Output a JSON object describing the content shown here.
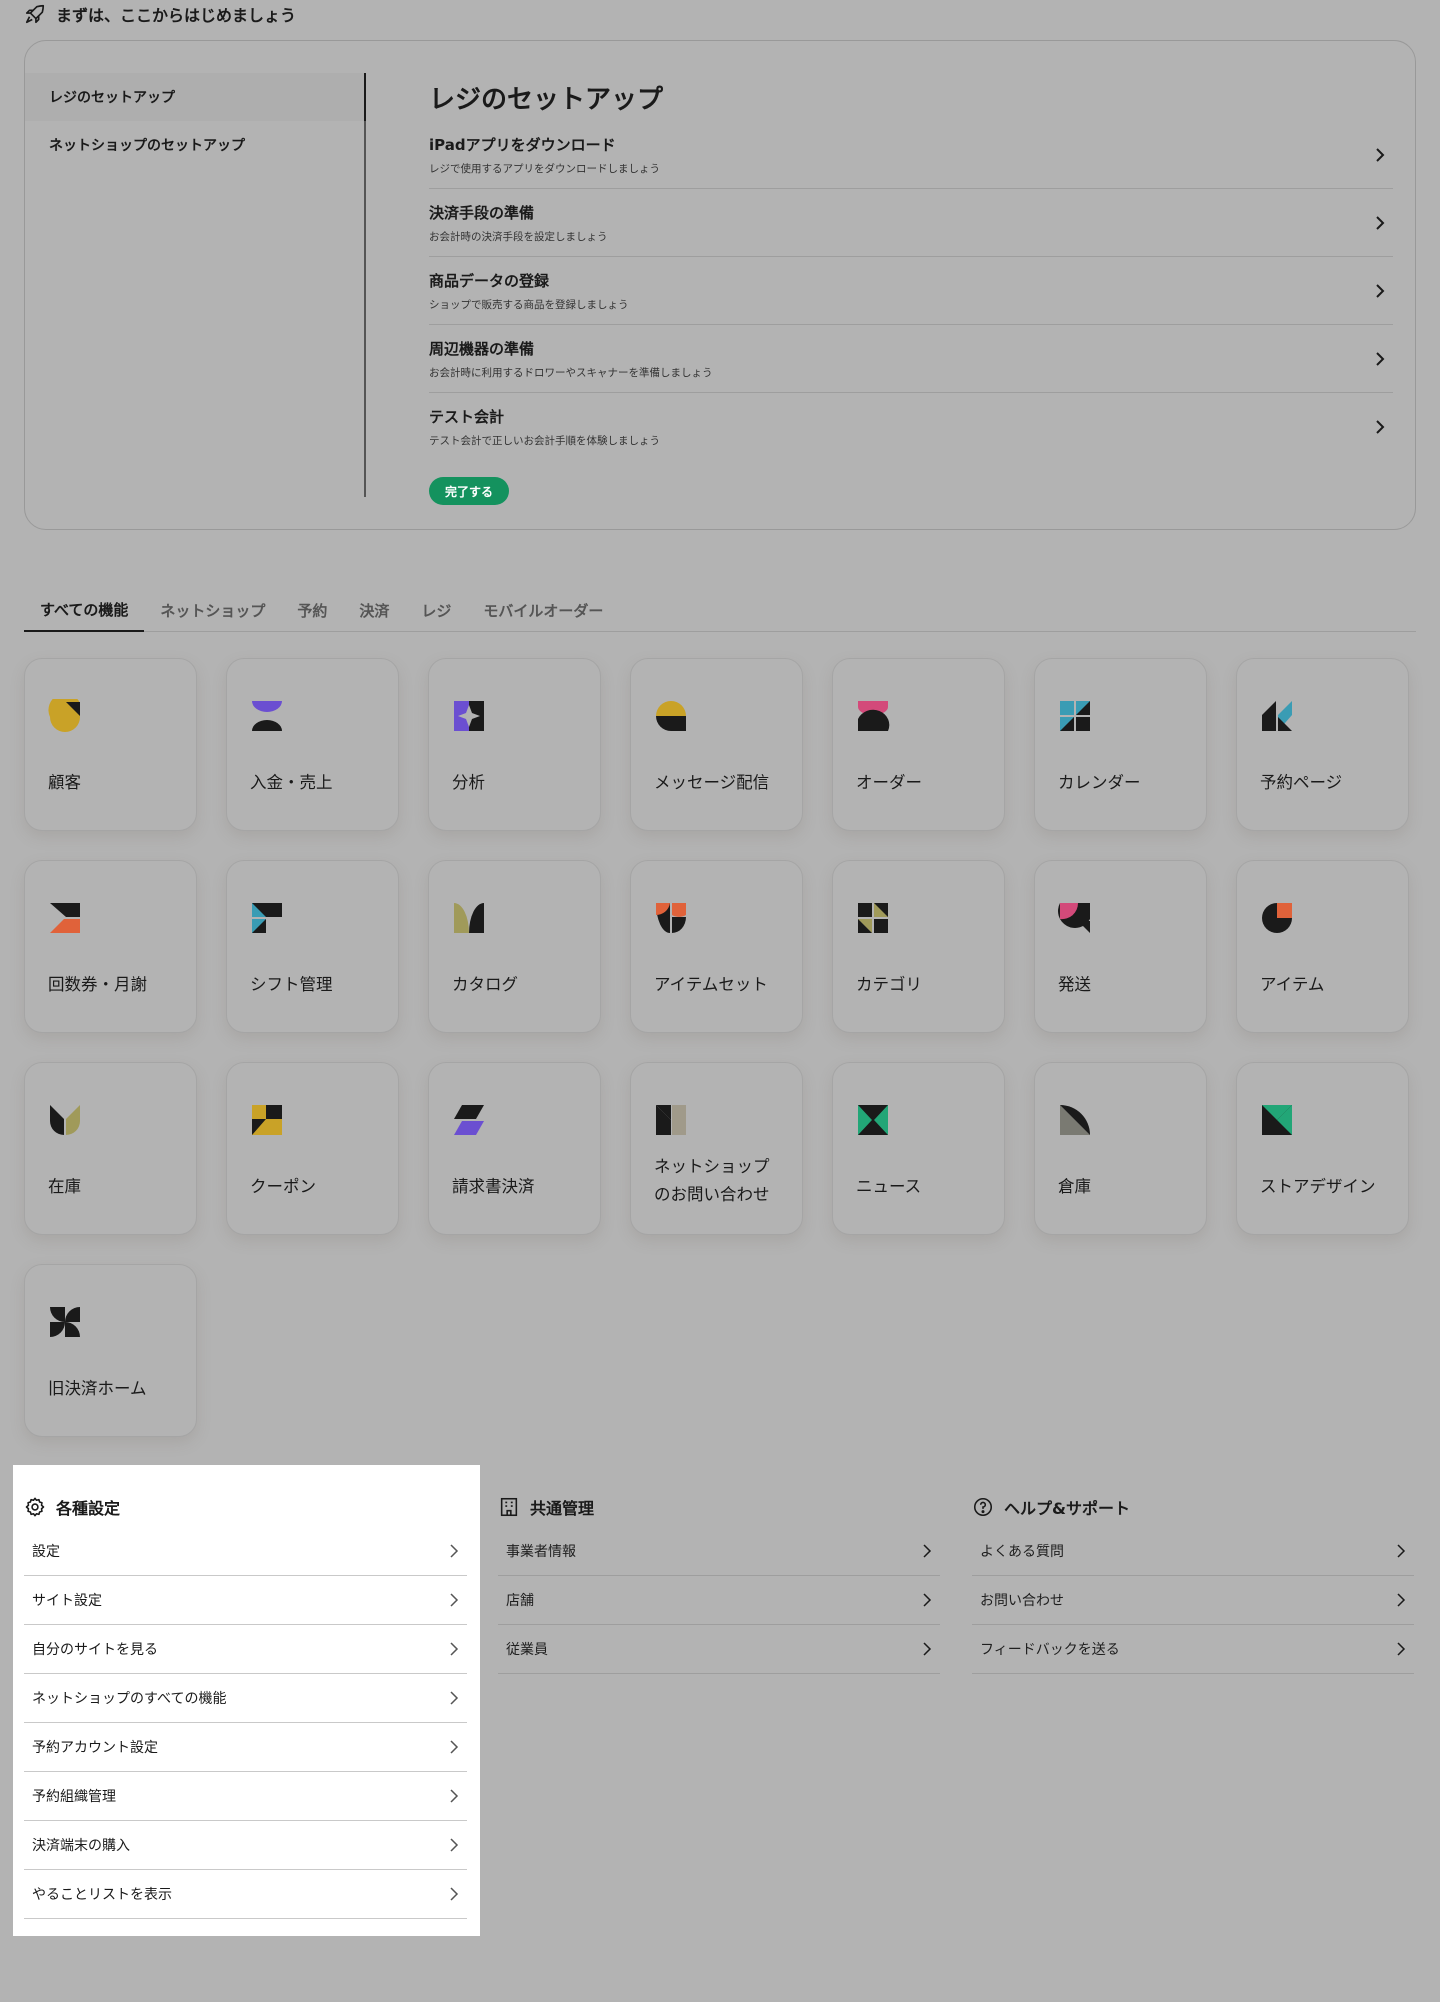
{
  "start": {
    "title": "まずは、ここからはじめましょう"
  },
  "setup": {
    "side_items": [
      "レジのセットアップ",
      "ネットショップのセットアップ"
    ],
    "heading": "レジのセットアップ",
    "steps": [
      {
        "title": "iPadアプリをダウンロード",
        "desc": "レジで使用するアプリをダウンロードしましょう"
      },
      {
        "title": "決済手段の準備",
        "desc": "お会計時の決済手段を設定しましょう"
      },
      {
        "title": "商品データの登録",
        "desc": "ショップで販売する商品を登録しましょう"
      },
      {
        "title": "周辺機器の準備",
        "desc": "お会計時に利用するドロワーやスキャナーを準備しましょう"
      },
      {
        "title": "テスト会計",
        "desc": "テスト会計で正しいお会計手順を体験しましょう"
      }
    ],
    "complete_label": "完了する"
  },
  "tabs": [
    "すべての機能",
    "ネットショップ",
    "予約",
    "決済",
    "レジ",
    "モバイルオーダー"
  ],
  "features": [
    {
      "label": "顧客",
      "icon": "customer-icon"
    },
    {
      "label": "入金・売上",
      "icon": "deposit-sales-icon"
    },
    {
      "label": "分析",
      "icon": "analytics-icon"
    },
    {
      "label": "メッセージ配信",
      "icon": "message-icon"
    },
    {
      "label": "オーダー",
      "icon": "order-icon"
    },
    {
      "label": "カレンダー",
      "icon": "calendar-icon"
    },
    {
      "label": "予約ページ",
      "icon": "reservation-page-icon"
    },
    {
      "label": "回数券・月謝",
      "icon": "ticket-icon"
    },
    {
      "label": "シフト管理",
      "icon": "shift-icon"
    },
    {
      "label": "カタログ",
      "icon": "catalog-icon"
    },
    {
      "label": "アイテムセット",
      "icon": "item-set-icon"
    },
    {
      "label": "カテゴリ",
      "icon": "category-icon"
    },
    {
      "label": "発送",
      "icon": "shipping-icon"
    },
    {
      "label": "アイテム",
      "icon": "item-icon"
    },
    {
      "label": "在庫",
      "icon": "inventory-icon"
    },
    {
      "label": "クーポン",
      "icon": "coupon-icon"
    },
    {
      "label": "請求書決済",
      "icon": "invoice-icon"
    },
    {
      "label": "ネットショップ\nのお問い合わせ",
      "icon": "inquiry-icon"
    },
    {
      "label": "ニュース",
      "icon": "news-icon"
    },
    {
      "label": "倉庫",
      "icon": "warehouse-icon"
    },
    {
      "label": "ストアデザイン",
      "icon": "store-design-icon"
    },
    {
      "label": "旧決済ホーム",
      "icon": "legacy-payment-icon"
    }
  ],
  "settings": {
    "title": "各種設定",
    "items": [
      "設定",
      "サイト設定",
      "自分のサイトを見る",
      "ネットショップのすべての機能",
      "予約アカウント設定",
      "予約組織管理",
      "決済端末の購入",
      "やることリストを表示"
    ]
  },
  "common": {
    "title": "共通管理",
    "items": [
      "事業者情報",
      "店舗",
      "従業員"
    ]
  },
  "help": {
    "title": "ヘルプ&サポート",
    "items": [
      "よくある質問",
      "お問い合わせ",
      "フィードバックを送る"
    ]
  },
  "colors": {
    "overlay": "#b3b3b3",
    "accent_green": "#14925e",
    "yellow": "#c9a227",
    "purple": "#6b4fd1",
    "pink": "#d34a7a",
    "teal": "#3a9cb4",
    "orange": "#e0623a",
    "olive": "#a09a5a",
    "green": "#22a677",
    "dark": "#1a1a1a"
  }
}
